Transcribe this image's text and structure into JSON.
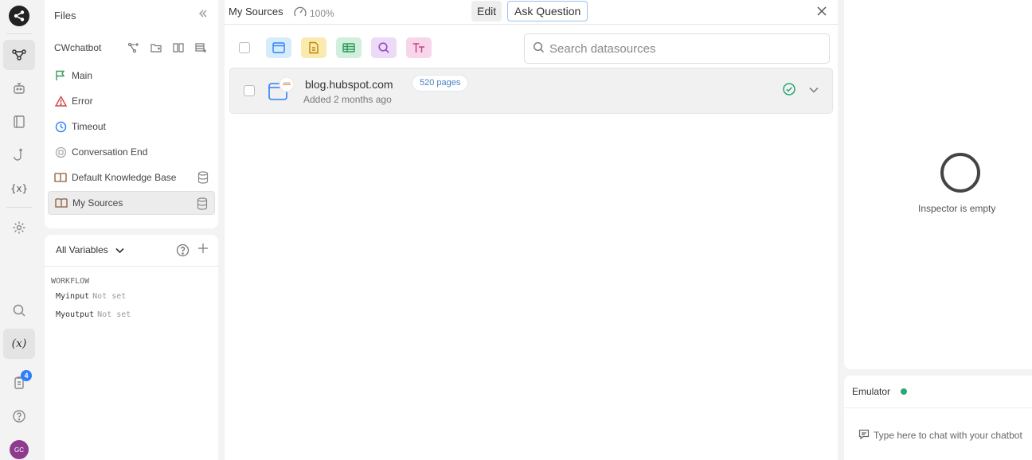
{
  "rail": {
    "notification_count": "4",
    "avatar_initials": "GC",
    "variables_icon_text": "{x}",
    "variables_active_text": "(x)"
  },
  "files": {
    "title": "Files",
    "project_name": "CWchatbot",
    "items": [
      {
        "label": "Main",
        "icon": "flag-icon"
      },
      {
        "label": "Error",
        "icon": "warning-icon"
      },
      {
        "label": "Timeout",
        "icon": "clock-icon"
      },
      {
        "label": "Conversation End",
        "icon": "stop-circle-icon"
      },
      {
        "label": "Default Knowledge Base",
        "icon": "book-icon"
      },
      {
        "label": "My Sources",
        "icon": "book-icon",
        "selected": true
      }
    ]
  },
  "variables": {
    "dropdown_label": "All Variables",
    "section": "WORKFLOW",
    "rows": [
      {
        "name": "Myinput",
        "value": "Not set"
      },
      {
        "name": "Myoutput",
        "value": "Not set"
      }
    ]
  },
  "main": {
    "title": "My Sources",
    "progress_label": "100%",
    "edit_label": "Edit",
    "ask_label": "Ask Question",
    "search_placeholder": "Search datasources",
    "filters": [
      {
        "icon": "browser-icon",
        "bg": "#d7ecfb"
      },
      {
        "icon": "document-icon",
        "bg": "#faeab0"
      },
      {
        "icon": "table-icon",
        "bg": "#d2efdd"
      },
      {
        "icon": "search-icon",
        "bg": "#ecdaf6"
      },
      {
        "icon": "text-icon",
        "bg": "#f8d6e9"
      }
    ],
    "sources": [
      {
        "name": "blog.hubspot.com",
        "added": "Added 2 months ago",
        "pages": "520 pages",
        "status": "ok"
      }
    ]
  },
  "inspector": {
    "empty_text": "Inspector is empty"
  },
  "emulator": {
    "title": "Emulator",
    "input_placeholder": "Type here to chat with your chatbot"
  },
  "colors": {
    "accent": "#2d7ff9",
    "success": "#2aa876",
    "avatar": "#8e3b8f"
  }
}
